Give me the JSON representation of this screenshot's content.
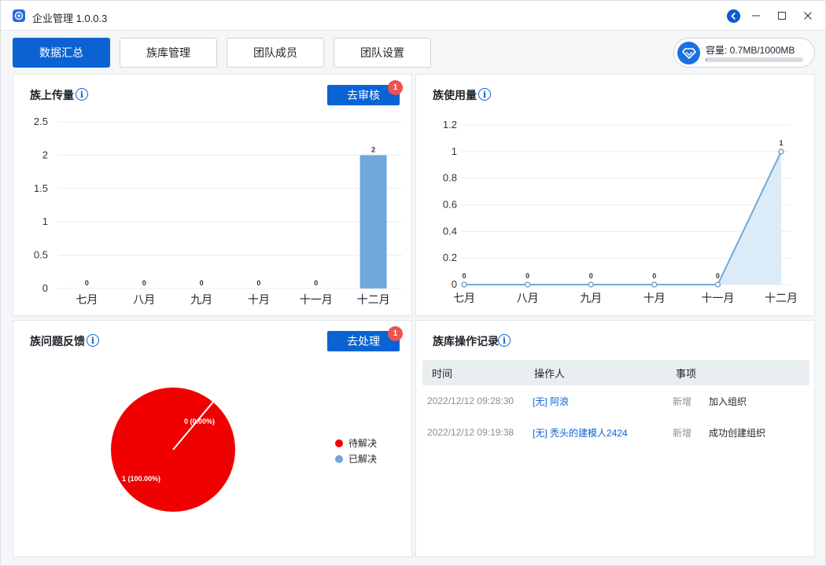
{
  "window": {
    "title": "企业管理 1.0.0.3",
    "controls": {
      "minimize": "—",
      "maximize": "☐",
      "close": "✕"
    }
  },
  "tabs": [
    {
      "label": "数据汇总",
      "active": true
    },
    {
      "label": "族库管理",
      "active": false
    },
    {
      "label": "团队成员",
      "active": false
    },
    {
      "label": "团队设置",
      "active": false
    }
  ],
  "capacity": {
    "label": "容量: 0.7MB/1000MB",
    "used_fraction": 0.0007
  },
  "upload_panel": {
    "title": "族上传量",
    "button_label": "去审核",
    "badge": "1"
  },
  "usage_panel": {
    "title": "族使用量"
  },
  "feedback_panel": {
    "title": "族问题反馈",
    "button_label": "去处理",
    "badge": "1",
    "legend": [
      {
        "label": "待解决",
        "color": "#f00000"
      },
      {
        "label": "已解决",
        "color": "#6fa8dc"
      }
    ]
  },
  "log_panel": {
    "title": "族库操作记录",
    "columns": [
      "时间",
      "操作人",
      "事项"
    ],
    "rows": [
      {
        "time": "2022/12/12 09:28:30",
        "operator": "[无] 阿浪",
        "type": "新增",
        "item": "加入组织"
      },
      {
        "time": "2022/12/12 09:19:38",
        "operator": "[无] 秃头的建模人2424",
        "type": "新增",
        "item": "成功创建组织"
      }
    ]
  },
  "chart_data": [
    {
      "type": "bar",
      "categories": [
        "七月",
        "八月",
        "九月",
        "十月",
        "十一月",
        "十二月"
      ],
      "values": [
        0,
        0,
        0,
        0,
        0,
        2
      ],
      "ylim": [
        0,
        2.5
      ],
      "yticks": [
        "0",
        "0.5",
        "1",
        "1.5",
        "2",
        "2.5"
      ],
      "color": "#6fa8dc",
      "grid": true
    },
    {
      "type": "area",
      "categories": [
        "七月",
        "八月",
        "九月",
        "十月",
        "十一月",
        "十二月"
      ],
      "values": [
        0,
        0,
        0,
        0,
        0,
        1
      ],
      "ylim": [
        0,
        1.2
      ],
      "yticks": [
        "0",
        "0.2",
        "0.4",
        "0.6",
        "0.8",
        "1",
        "1.2"
      ],
      "color": "#6fa8dc",
      "grid": true
    },
    {
      "type": "pie",
      "slices": [
        {
          "label": "待解决",
          "value": 1,
          "data_label": "1 (100.00%)",
          "color": "#f00000"
        },
        {
          "label": "已解决",
          "value": 0,
          "data_label": "0 (0.00%)",
          "color": "#6fa8dc"
        }
      ]
    }
  ]
}
